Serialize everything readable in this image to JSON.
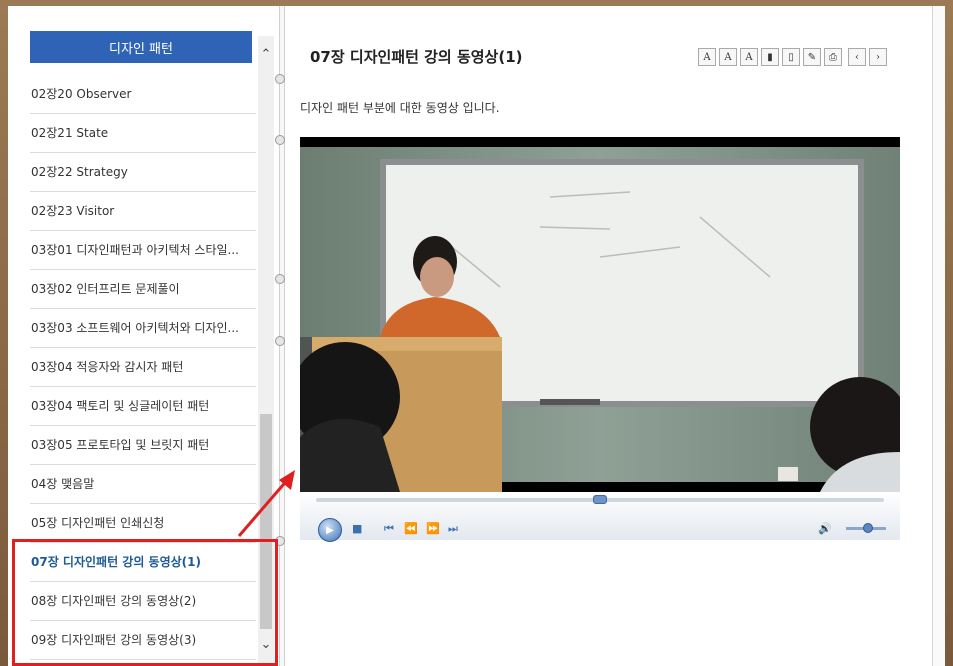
{
  "sidebar": {
    "header": "디자인 패턴",
    "items": [
      "02장20 Observer",
      "02장21 State",
      "02장22 Strategy",
      "02장23 Visitor",
      "03장01 디자인패턴과 아키텍처 스타일...",
      "03장02 인터프리트 문제풀이",
      "03장03 소프트웨어 아키텍처와 디자인...",
      "03장04 적응자와 감시자 패턴",
      "03장04 팩토리 및 싱글레이턴 패턴",
      "03장05 프로토타입 및 브릿지 패턴",
      "04장 맺음말",
      "05장 디자인패턴 인쇄신청",
      "07장 디자인패턴 강의 동영상(1)",
      "08장 디자인패턴 강의 동영상(2)",
      "09장 디자인패턴 강의 동영상(3)"
    ],
    "active_index": 12
  },
  "main": {
    "title": "07장 디자인패턴 강의 동영상(1)",
    "description": "디자인 패턴 부분에 대한 동영상 입니다."
  },
  "player": {
    "seek_position": 0.5,
    "volume": 0.55
  },
  "colors": {
    "header_bg": "#2f63b5",
    "active_item": "#1d5a95",
    "highlight": "#e02020"
  }
}
